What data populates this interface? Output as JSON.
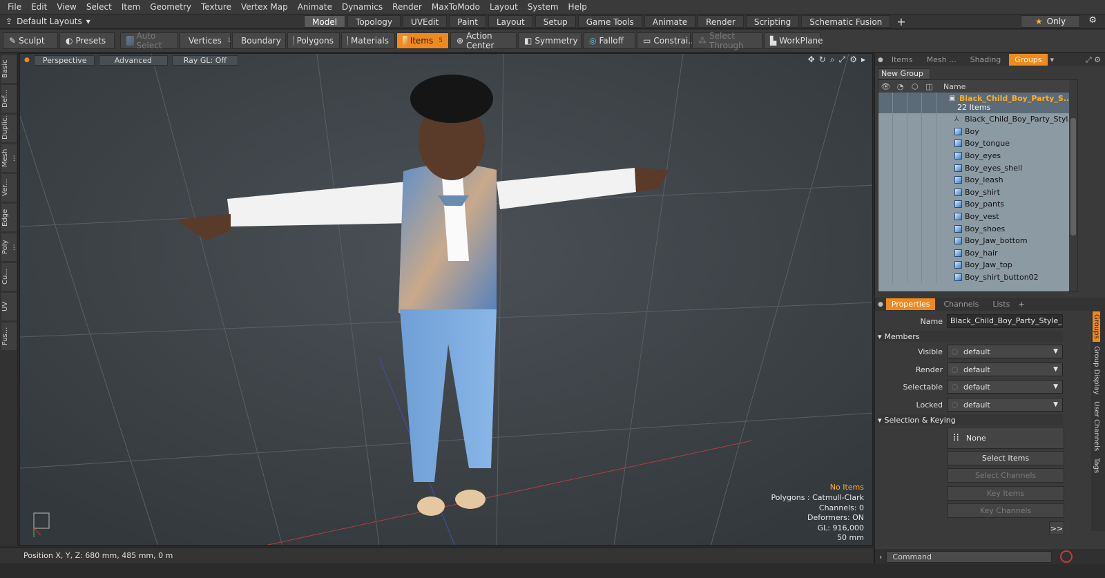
{
  "menu": [
    "File",
    "Edit",
    "View",
    "Select",
    "Item",
    "Geometry",
    "Texture",
    "Vertex Map",
    "Animate",
    "Dynamics",
    "Render",
    "MaxToModo",
    "Layout",
    "System",
    "Help"
  ],
  "layout_selector": "Default Layouts",
  "layout_tabs": [
    {
      "label": "Model",
      "active": true
    },
    {
      "label": "Topology"
    },
    {
      "label": "UVEdit"
    },
    {
      "label": "Paint"
    },
    {
      "label": "Layout"
    },
    {
      "label": "Setup"
    },
    {
      "label": "Game Tools"
    },
    {
      "label": "Animate"
    },
    {
      "label": "Render"
    },
    {
      "label": "Scripting"
    },
    {
      "label": "Schematic Fusion"
    }
  ],
  "only_label": "Only",
  "toolbar": {
    "sculpt": "Sculpt",
    "presets": "Presets",
    "auto_select": "Auto Select",
    "vertices": "Vertices",
    "vertices_count": "1",
    "boundary": "Boundary",
    "polygons": "Polygons",
    "materials": "Materials",
    "items": "Items",
    "items_count": "5",
    "action_center": "Action Center",
    "symmetry": "Symmetry",
    "falloff": "Falloff",
    "constrain": "Constrai...",
    "select_through": "Select Through",
    "workplane": "WorkPlane"
  },
  "left_tabs": [
    "Basic",
    "Def...",
    "Duplic...",
    "Mesh ...",
    "Ver...",
    "Edge",
    "Poly ...",
    "Cu...",
    "UV",
    "Fus..."
  ],
  "viewport": {
    "view_mode": "Perspective",
    "advanced": "Advanced",
    "raygl": "Ray GL: Off",
    "info": {
      "no_items": "No Items",
      "polygons": "Polygons : Catmull-Clark",
      "channels": "Channels: 0",
      "deformers": "Deformers: ON",
      "gl": "GL: 916,000",
      "scale": "50 mm"
    }
  },
  "status": {
    "position": "Position X, Y, Z:  680 mm, 485 mm, 0 m"
  },
  "right_panel": {
    "tabs": [
      {
        "label": "Items"
      },
      {
        "label": "Mesh ..."
      },
      {
        "label": "Shading"
      },
      {
        "label": "Groups",
        "active": true
      }
    ],
    "new_group": "New Group",
    "tree_header_name": "Name",
    "group_name": "Black_Child_Boy_Party_S...",
    "group_count": "22 Items",
    "items": [
      "Black_Child_Boy_Party_Styl...",
      "Boy",
      "Boy_tongue",
      "Boy_eyes",
      "Boy_eyes_shell",
      "Boy_leash",
      "Boy_shirt",
      "Boy_pants",
      "Boy_vest",
      "Boy_shoes",
      "Boy_Jaw_bottom",
      "Boy_hair",
      "Boy_Jaw_top",
      "Boy_shirt_button02"
    ]
  },
  "properties": {
    "tabs": [
      {
        "label": "Properties",
        "active": true
      },
      {
        "label": "Channels"
      },
      {
        "label": "Lists"
      }
    ],
    "name_label": "Name",
    "name_value": "Black_Child_Boy_Party_Style_T_f",
    "members_section": "Members",
    "visible_label": "Visible",
    "visible_value": "default",
    "render_label": "Render",
    "render_value": "default",
    "selectable_label": "Selectable",
    "selectable_value": "default",
    "locked_label": "Locked",
    "locked_value": "default",
    "keying_section": "Selection & Keying",
    "none_label": "None",
    "select_items": "Select Items",
    "select_channels": "Select Channels",
    "key_items": "Key Items",
    "key_channels": "Key Channels",
    "more": ">>"
  },
  "side_tabs": [
    "Groups",
    "Group Display",
    "User Channels",
    "Tags"
  ],
  "command_placeholder": "Command",
  "colors": {
    "accent": "#f0891e",
    "viewport_bg": "#3e4347",
    "tree_bg": "#8c9aa3"
  }
}
